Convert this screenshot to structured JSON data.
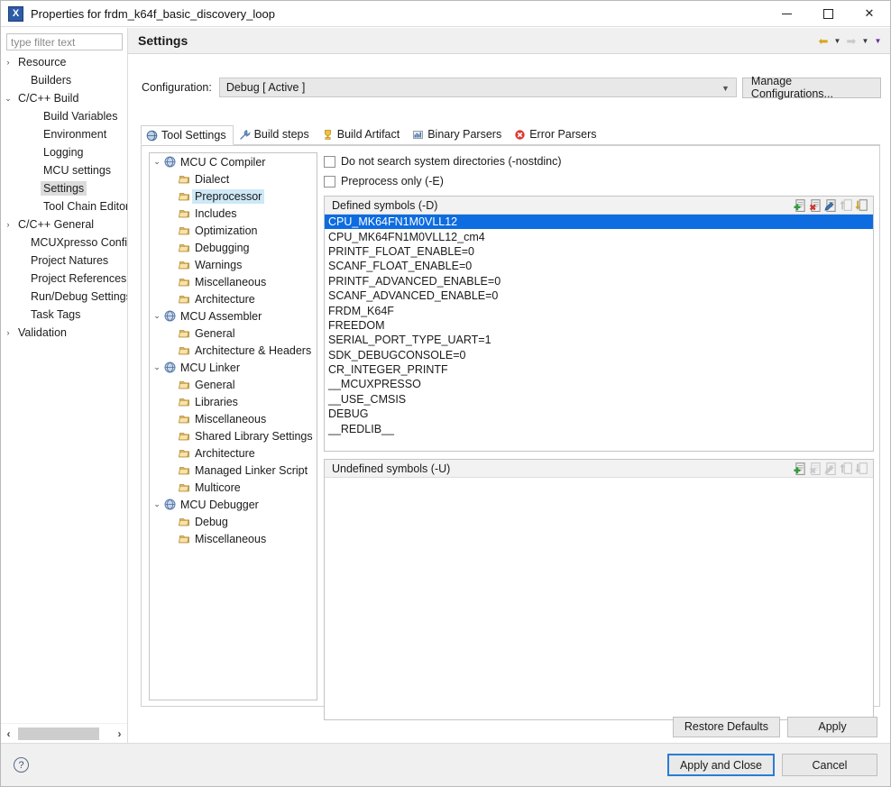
{
  "window": {
    "title": "Properties for frdm_k64f_basic_discovery_loop",
    "icon": "eclipse-x-icon",
    "minimize_label": "Minimize",
    "maximize_label": "Maximize",
    "close_label": "Close"
  },
  "filter": {
    "placeholder": "type filter text",
    "value": ""
  },
  "nav_tree": [
    {
      "label": "Resource",
      "twisty": "›",
      "indent": 0,
      "selected": false
    },
    {
      "label": "Builders",
      "twisty": "",
      "indent": 1,
      "selected": false
    },
    {
      "label": "C/C++ Build",
      "twisty": "⌄",
      "indent": 0,
      "selected": false
    },
    {
      "label": "Build Variables",
      "twisty": "",
      "indent": 2,
      "selected": false
    },
    {
      "label": "Environment",
      "twisty": "",
      "indent": 2,
      "selected": false
    },
    {
      "label": "Logging",
      "twisty": "",
      "indent": 2,
      "selected": false
    },
    {
      "label": "MCU settings",
      "twisty": "",
      "indent": 2,
      "selected": false
    },
    {
      "label": "Settings",
      "twisty": "",
      "indent": 2,
      "selected": true
    },
    {
      "label": "Tool Chain Editor",
      "twisty": "",
      "indent": 2,
      "selected": false
    },
    {
      "label": "C/C++ General",
      "twisty": "›",
      "indent": 0,
      "selected": false
    },
    {
      "label": "MCUXpresso Config T",
      "twisty": "",
      "indent": 1,
      "selected": false
    },
    {
      "label": "Project Natures",
      "twisty": "",
      "indent": 1,
      "selected": false
    },
    {
      "label": "Project References",
      "twisty": "",
      "indent": 1,
      "selected": false
    },
    {
      "label": "Run/Debug Settings",
      "twisty": "",
      "indent": 1,
      "selected": false
    },
    {
      "label": "Task Tags",
      "twisty": "",
      "indent": 1,
      "selected": false
    },
    {
      "label": "Validation",
      "twisty": "›",
      "indent": 0,
      "selected": false
    }
  ],
  "page": {
    "title": "Settings",
    "nav_back_icon": "arrow-back-icon",
    "nav_back_menu_icon": "chevron-down-icon",
    "nav_forward_icon": "arrow-forward-icon",
    "nav_forward_menu_icon": "chevron-down-icon",
    "view_menu_icon": "chevron-down-purple-icon"
  },
  "configuration": {
    "label": "Configuration:",
    "value": "Debug  [ Active ]",
    "dropdown_icon": "chevron-down-icon",
    "manage_button": "Manage Configurations..."
  },
  "tabs": [
    {
      "label": "Tool Settings",
      "icon": "tool-settings-icon",
      "active": true
    },
    {
      "label": "Build steps",
      "icon": "wrench-icon",
      "active": false
    },
    {
      "label": "Build Artifact",
      "icon": "trophy-icon",
      "active": false
    },
    {
      "label": "Binary Parsers",
      "icon": "binary-icon",
      "active": false
    },
    {
      "label": "Error Parsers",
      "icon": "error-icon",
      "active": false
    }
  ],
  "tool_tree": [
    {
      "label": "MCU C Compiler",
      "twisty": "⌄",
      "indent": 0,
      "icon": "tool-icon",
      "selected": false
    },
    {
      "label": "Dialect",
      "twisty": "",
      "indent": 1,
      "icon": "page-icon",
      "selected": false
    },
    {
      "label": "Preprocessor",
      "twisty": "",
      "indent": 1,
      "icon": "page-icon",
      "selected": true
    },
    {
      "label": "Includes",
      "twisty": "",
      "indent": 1,
      "icon": "page-icon",
      "selected": false
    },
    {
      "label": "Optimization",
      "twisty": "",
      "indent": 1,
      "icon": "page-icon",
      "selected": false
    },
    {
      "label": "Debugging",
      "twisty": "",
      "indent": 1,
      "icon": "page-icon",
      "selected": false
    },
    {
      "label": "Warnings",
      "twisty": "",
      "indent": 1,
      "icon": "page-icon",
      "selected": false
    },
    {
      "label": "Miscellaneous",
      "twisty": "",
      "indent": 1,
      "icon": "page-icon",
      "selected": false
    },
    {
      "label": "Architecture",
      "twisty": "",
      "indent": 1,
      "icon": "page-icon",
      "selected": false
    },
    {
      "label": "MCU Assembler",
      "twisty": "⌄",
      "indent": 0,
      "icon": "tool-icon",
      "selected": false
    },
    {
      "label": "General",
      "twisty": "",
      "indent": 1,
      "icon": "page-icon",
      "selected": false
    },
    {
      "label": "Architecture & Headers",
      "twisty": "",
      "indent": 1,
      "icon": "page-icon",
      "selected": false
    },
    {
      "label": "MCU Linker",
      "twisty": "⌄",
      "indent": 0,
      "icon": "tool-icon",
      "selected": false
    },
    {
      "label": "General",
      "twisty": "",
      "indent": 1,
      "icon": "page-icon",
      "selected": false
    },
    {
      "label": "Libraries",
      "twisty": "",
      "indent": 1,
      "icon": "page-icon",
      "selected": false
    },
    {
      "label": "Miscellaneous",
      "twisty": "",
      "indent": 1,
      "icon": "page-icon",
      "selected": false
    },
    {
      "label": "Shared Library Settings",
      "twisty": "",
      "indent": 1,
      "icon": "page-icon",
      "selected": false
    },
    {
      "label": "Architecture",
      "twisty": "",
      "indent": 1,
      "icon": "page-icon",
      "selected": false
    },
    {
      "label": "Managed Linker Script",
      "twisty": "",
      "indent": 1,
      "icon": "page-icon",
      "selected": false
    },
    {
      "label": "Multicore",
      "twisty": "",
      "indent": 1,
      "icon": "page-icon",
      "selected": false
    },
    {
      "label": "MCU Debugger",
      "twisty": "⌄",
      "indent": 0,
      "icon": "tool-icon",
      "selected": false
    },
    {
      "label": "Debug",
      "twisty": "",
      "indent": 1,
      "icon": "page-icon",
      "selected": false
    },
    {
      "label": "Miscellaneous",
      "twisty": "",
      "indent": 1,
      "icon": "page-icon",
      "selected": false
    }
  ],
  "options": {
    "nostdinc": {
      "label": "Do not search system directories (-nostdinc)",
      "checked": false
    },
    "preprocess_only": {
      "label": "Preprocess only (-E)",
      "checked": false
    }
  },
  "defined_symbols": {
    "title": "Defined symbols (-D)",
    "toolbar": [
      {
        "name": "add-icon",
        "enabled": true
      },
      {
        "name": "delete-icon",
        "enabled": true
      },
      {
        "name": "edit-icon",
        "enabled": true
      },
      {
        "name": "move-up-icon",
        "enabled": false
      },
      {
        "name": "move-down-icon",
        "enabled": true
      }
    ],
    "items": [
      "CPU_MK64FN1M0VLL12",
      "CPU_MK64FN1M0VLL12_cm4",
      "PRINTF_FLOAT_ENABLE=0",
      "SCANF_FLOAT_ENABLE=0",
      "PRINTF_ADVANCED_ENABLE=0",
      "SCANF_ADVANCED_ENABLE=0",
      "FRDM_K64F",
      "FREEDOM",
      "SERIAL_PORT_TYPE_UART=1",
      "SDK_DEBUGCONSOLE=0",
      "CR_INTEGER_PRINTF",
      "__MCUXPRESSO",
      "__USE_CMSIS",
      "DEBUG",
      "__REDLIB__"
    ],
    "selected_index": 0,
    "selection_color": "#0d6ce0"
  },
  "undefined_symbols": {
    "title": "Undefined symbols (-U)",
    "toolbar": [
      {
        "name": "add-icon",
        "enabled": true
      },
      {
        "name": "delete-icon",
        "enabled": false
      },
      {
        "name": "edit-icon",
        "enabled": false
      },
      {
        "name": "move-up-icon",
        "enabled": false
      },
      {
        "name": "move-down-icon",
        "enabled": false
      }
    ],
    "items": []
  },
  "buttons": {
    "restore_defaults": "Restore Defaults",
    "apply": "Apply",
    "apply_and_close": "Apply and Close",
    "cancel": "Cancel",
    "help_icon": "help-icon"
  },
  "colors": {
    "accent": "#0d6ce0",
    "tree_selection": "#cde8f6",
    "nav_selection": "#dcdcdc",
    "panel_bg": "#f0f0f0",
    "primary_border": "#2b7cd3"
  }
}
